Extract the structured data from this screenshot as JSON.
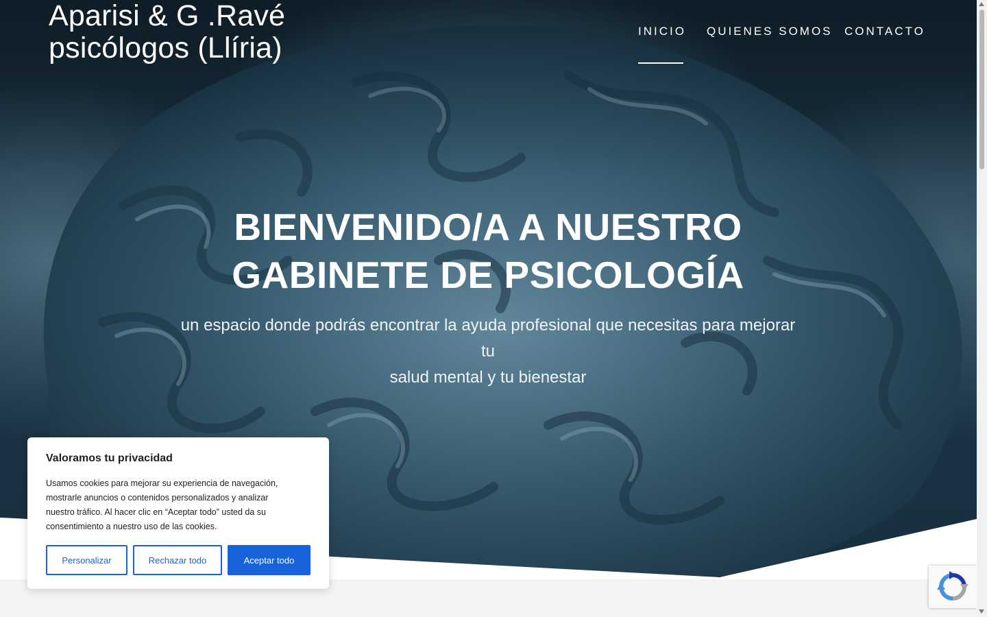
{
  "site": {
    "logo_line1": "Aparisi & G .Ravé",
    "logo_line2": "psicólogos (Llíria)"
  },
  "nav": {
    "items": [
      {
        "label": "INICIO",
        "active": true
      },
      {
        "label": "QUIENES SOMOS",
        "active": false
      },
      {
        "label": "CONTACTO",
        "active": false
      }
    ]
  },
  "hero": {
    "title_line1": "BIENVENIDO/A A NUESTRO",
    "title_line2": "GABINETE DE PSICOLOGÍA",
    "subtitle_line1": "un espacio donde podrás encontrar la ayuda profesional que necesitas para mejorar tu",
    "subtitle_line2": "salud mental y tu bienestar",
    "background_icon": "brain-image"
  },
  "cookie_banner": {
    "title": "Valoramos tu privacidad",
    "text_lines": [
      "Usamos cookies para mejorar su experiencia de navegación,",
      "mostrarle anuncios o contenidos personalizados y analizar",
      "nuestro tráfico. Al hacer clic en “Aceptar todo” usted da su",
      "consentimiento a nuestro uso de las cookies."
    ],
    "customize_label": "Personalizar",
    "reject_label": "Rechazar todo",
    "accept_label": "Aceptar todo"
  },
  "recaptcha": {
    "icon": "recaptcha-icon"
  },
  "colors": {
    "accent": "#1863dc",
    "hero_dark": "#1d3747",
    "page_bg": "#f4f4f4"
  }
}
